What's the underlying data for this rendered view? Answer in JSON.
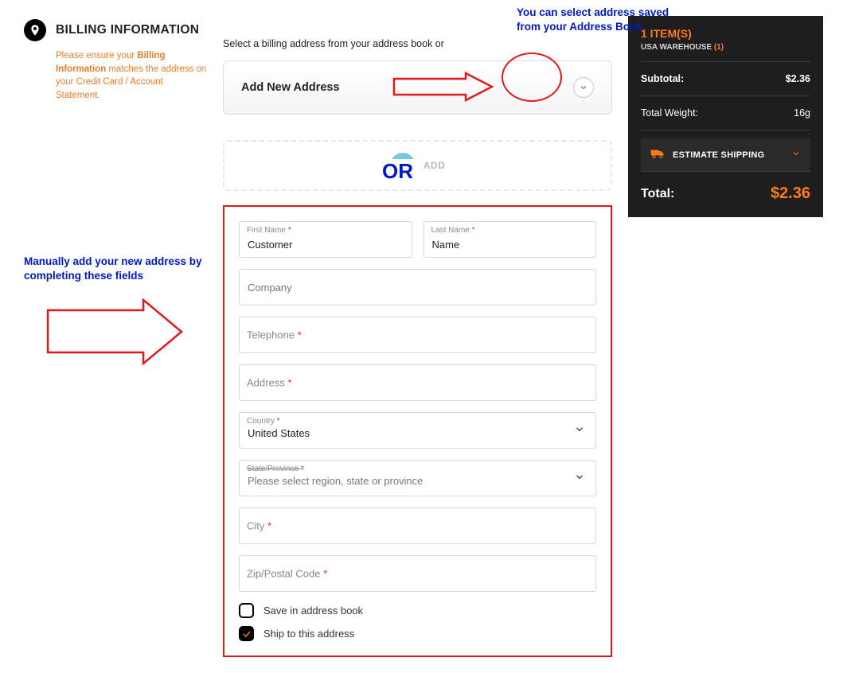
{
  "billing": {
    "title": "BILLING INFORMATION",
    "note_prefix": "Please ensure your ",
    "note_bold": "Billing Information",
    "note_suffix": " matches the address on your Credit Card / Account Statement."
  },
  "instruct": "Select a billing address from your address book or",
  "dropdown": {
    "label": "Add New Address"
  },
  "add_strip": {
    "label": "ADD"
  },
  "annotations": {
    "top": "You can select address saved from your Address Book",
    "or": "OR",
    "left": "Manually add your new address by completing these fields"
  },
  "form": {
    "first_name": {
      "label": "First Name",
      "value": "Customer"
    },
    "last_name": {
      "label": "Last Name",
      "value": "Name"
    },
    "company": {
      "placeholder": "Company"
    },
    "telephone": {
      "placeholder": "Telephone"
    },
    "address": {
      "placeholder": "Address"
    },
    "country": {
      "label": "Country",
      "value": "United States"
    },
    "state_label": "State/Province",
    "state_placeholder": "Please select region, state or province",
    "city": {
      "placeholder": "City"
    },
    "zip": {
      "placeholder": "Zip/Postal Code"
    },
    "save_book": "Save in address book",
    "ship_here": "Ship to this address"
  },
  "summary": {
    "title": "1 ITEM(S)",
    "warehouse": "USA WAREHOUSE",
    "warehouse_count": "(1)",
    "subtotal_label": "Subtotal:",
    "subtotal_val": "$2.36",
    "weight_label": "Total Weight:",
    "weight_val": "16g",
    "estimate": "ESTIMATE SHIPPING",
    "total_label": "Total:",
    "total_val": "$2.36"
  }
}
